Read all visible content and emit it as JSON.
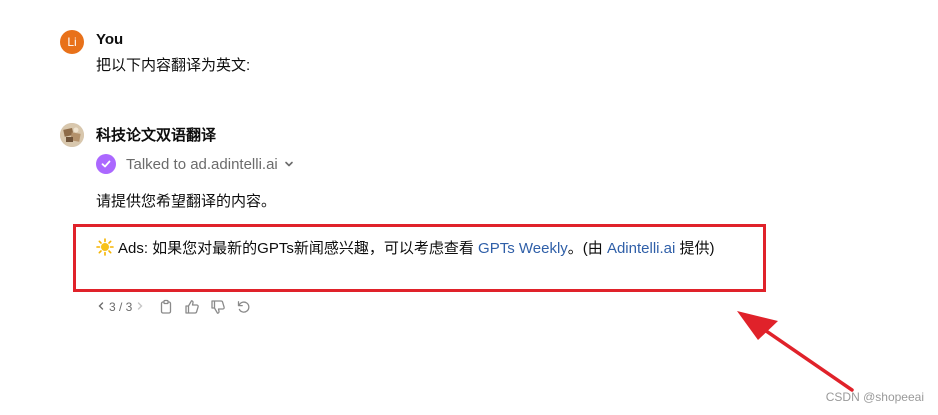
{
  "user": {
    "avatar_text": "Li",
    "name": "You",
    "message": "把以下内容翻译为英文:"
  },
  "assistant": {
    "name": "科技论文双语翻译",
    "talked_to": "Talked to ad.adintelli.ai",
    "reply": "请提供您希望翻译的内容。",
    "ad": {
      "prefix": "Ads: 如果您对最新的GPTs新闻感兴趣，可以考虑查看 ",
      "link1": "GPTs Weekly",
      "middle": "。(由 ",
      "link2": "Adintelli.ai",
      "suffix": " 提供)"
    }
  },
  "toolbar": {
    "page": "3 / 3",
    "prev_icon": "chevron-left-icon",
    "next_icon": "chevron-right-icon"
  },
  "colors": {
    "accent_purple": "#ab68ff",
    "link_blue": "#2f5fa8",
    "annotation_red": "#e0222a",
    "user_avatar": "#e8711a"
  },
  "watermark": "CSDN @shopeeai"
}
